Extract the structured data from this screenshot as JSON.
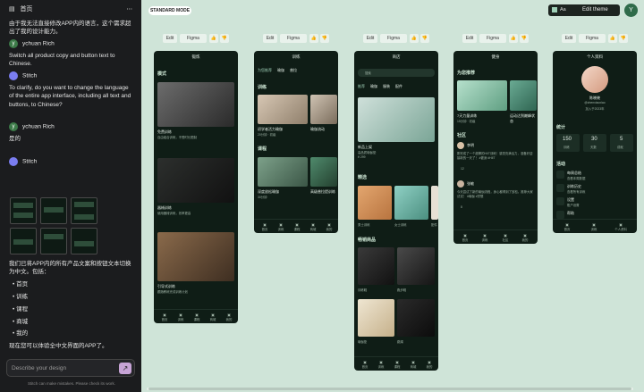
{
  "sidebar": {
    "title": "首页",
    "menu_icon": "⋯",
    "intro": "由于我无法直接修改APP内的语言，这个需求超出了我的设计能力。",
    "user_name": "ychuan Rich",
    "user_msg1": "Switch all product copy and button text to Chinese.",
    "bot_name": "Stitch",
    "bot_msg1": "To clarify, do you want to change the language of the entire app interface, including all text and buttons, to Chinese?",
    "user_msg2": "是的",
    "bot_msg2": "我们已将APP内的所有产品文案和按钮文本切换为中文。包括：",
    "list": [
      "首页",
      "训练",
      "课程",
      "商城",
      "我的"
    ],
    "closing": "现在您可以体验全中文界面的APP了。",
    "input_placeholder": "Describe your design",
    "disclaimer": "Stitch can make mistakes. Please check its work."
  },
  "topbar": {
    "mode": "STANDARD MODE",
    "theme_label": "Edit theme",
    "aa": "Aa",
    "avatar": "Y",
    "accent": "#2f6b4a"
  },
  "toolbar": {
    "edit": "Edit",
    "figma": "Figma"
  },
  "screens": [
    {
      "header": "锻炼",
      "section": "模式",
      "items": [
        {
          "t": "免费训练",
          "s": "自由组合训练，不受时长限制"
        },
        {
          "t": "器械训练",
          "s": "使用器械训练，效率更高"
        },
        {
          "t": "引导式训练",
          "s": "跟随教练完成训练计划"
        }
      ],
      "nav": [
        "首页",
        "训练",
        "课程",
        "商城",
        "我的"
      ]
    },
    {
      "header": "训练",
      "tabs": [
        "为您推荐",
        "瑜伽",
        "普拉"
      ],
      "section1": "训练",
      "cards1": [
        {
          "t": "初学者活力瑜伽",
          "s": "20分钟 · 初级"
        },
        {
          "t": "瑜伽流动",
          "s": "25分钟"
        }
      ],
      "section2": "课程",
      "cards2": [
        {
          "t": "深度放松瑜伽",
          "s": "30分钟"
        },
        {
          "t": "高级普拉提训练",
          "s": "45分钟"
        }
      ],
      "nav": [
        "首页",
        "训练",
        "课程",
        "商城",
        "我的"
      ]
    },
    {
      "header": "商店",
      "search": "搜索",
      "tabs": [
        "推荐",
        "瑜伽",
        "服装",
        "配件"
      ],
      "hero": {
        "t": "新品上架",
        "s": "高品质瑜伽垫",
        "p": "¥ 299"
      },
      "section1": "精选",
      "feat": [
        "男士训练",
        "女士训练",
        "配件"
      ],
      "section2": "畅销商品",
      "products": [
        "训练鞋",
        "跑步鞋",
        "瑜伽垫",
        "跳绳"
      ],
      "nav": [
        "首页",
        "训练",
        "课程",
        "商城",
        "我的"
      ]
    },
    {
      "header": "健身",
      "section1": "为您推荐",
      "rec": [
        {
          "t": "7天力量训练",
          "s": "15分钟 · 初级"
        },
        {
          "t": "运动达到巅峰状态",
          "s": "20分钟"
        }
      ],
      "section2": "社区",
      "posts": [
        {
          "n": "李明",
          "b": "刚完成了一个超棒的HIIT训练！感觉充满活力，准备好迎接新的一天了！ #健身 #HIIT",
          "l": "12"
        },
        {
          "n": "张敏",
          "b": "今天尝试了新的瑜伽流程，身心都得到了放松。推荐大家试试！ #瑜伽 #冥想",
          "l": "8"
        }
      ],
      "nav": [
        "首页",
        "训练",
        "社区",
        "我的"
      ]
    },
    {
      "header": "个人资料",
      "name": "陈晓晓",
      "handle": "@chenxiaoxiao",
      "member": "加入于2023年",
      "stats_title": "统计",
      "stats": [
        {
          "v": "150",
          "l": "训练"
        },
        {
          "v": "30",
          "l": "天数"
        },
        {
          "v": "5",
          "l": "成就"
        }
      ],
      "act_title": "活动",
      "acts": [
        {
          "t": "每周总结",
          "s": "查看本周数据"
        },
        {
          "t": "训练历史",
          "s": "查看所有训练"
        },
        {
          "t": "设置",
          "s": "账户设置"
        },
        {
          "t": "帮助",
          "s": "常见问题"
        }
      ],
      "nav": [
        "首页",
        "训练",
        "个人资料"
      ]
    }
  ]
}
